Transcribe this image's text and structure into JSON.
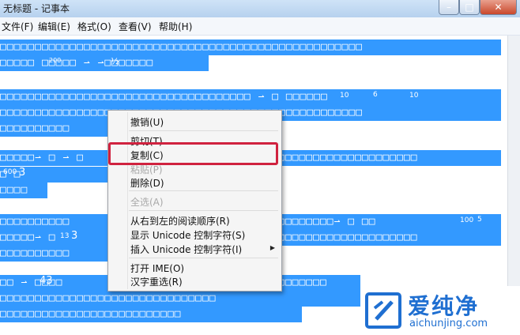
{
  "window": {
    "title": "无标题 - 记事本"
  },
  "menu": [
    "文件(F)",
    "编辑(E)",
    "格式(O)",
    "查看(V)",
    "帮助(H)"
  ],
  "fragments": [
    "200",
    "½",
    "10",
    "6",
    "600",
    "3",
    "13",
    "3",
    "43",
    "10",
    "100",
    "5"
  ],
  "context_menu": {
    "items": [
      {
        "label": "撤销(U)",
        "disabled": false
      },
      {
        "label": "剪切(T)",
        "disabled": false
      },
      {
        "label": "复制(C)",
        "disabled": false
      },
      {
        "label": "粘贴(P)",
        "disabled": true
      },
      {
        "label": "删除(D)",
        "disabled": false
      },
      {
        "label": "全选(A)",
        "disabled": true
      },
      {
        "label": "从右到左的阅读顺序(R)",
        "disabled": false
      },
      {
        "label": "显示 Unicode 控制字符(S)",
        "disabled": false
      },
      {
        "label": "插入 Unicode 控制字符(I)",
        "disabled": false,
        "submenu": true
      },
      {
        "label": "打开 IME(O)",
        "disabled": false
      },
      {
        "label": "汉字重选(R)",
        "disabled": false
      }
    ]
  },
  "watermark": {
    "cn": "爱纯净",
    "en": "aichunjing.com"
  },
  "colors": {
    "selection": "#3399ff",
    "highlight_box": "#d0223f",
    "watermark": "#1f6fd1"
  }
}
